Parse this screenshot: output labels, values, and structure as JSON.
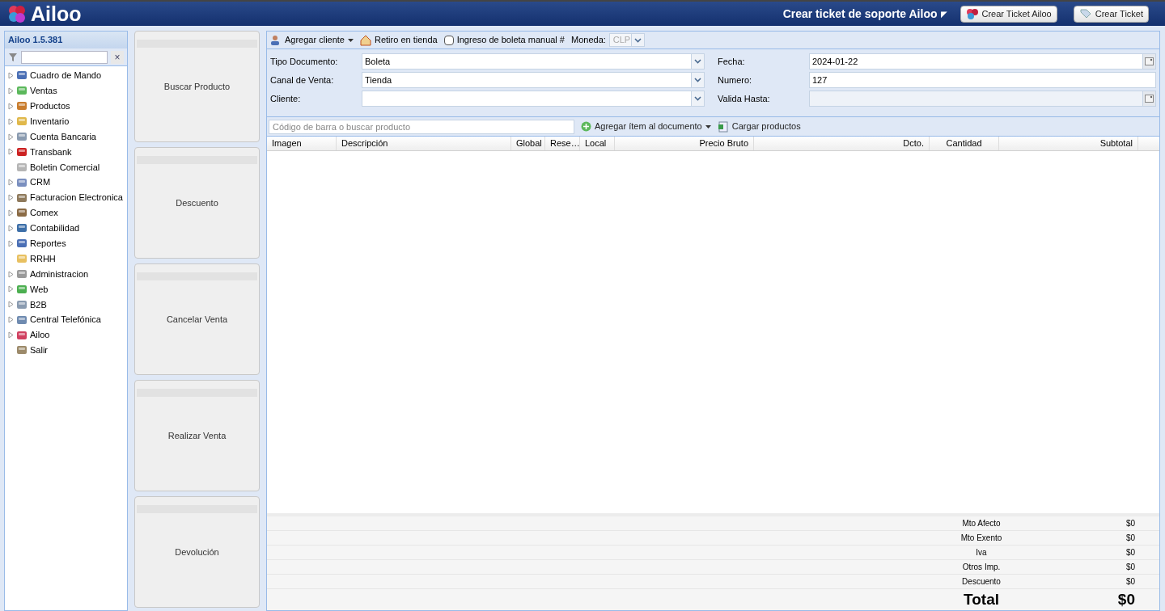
{
  "header": {
    "logo": "Ailoo",
    "support_title": "Crear ticket de soporte Ailoo",
    "support_caret": "◤",
    "buttons": [
      "Crear Ticket Ailoo",
      "Crear Ticket"
    ]
  },
  "sidebar": {
    "title": "Ailoo 1.5.381",
    "filter_clear": "×",
    "items": [
      {
        "label": "Cuadro de Mando",
        "expandable": true
      },
      {
        "label": "Ventas",
        "expandable": true
      },
      {
        "label": "Productos",
        "expandable": true
      },
      {
        "label": "Inventario",
        "expandable": true
      },
      {
        "label": "Cuenta Bancaria",
        "expandable": true
      },
      {
        "label": "Transbank",
        "expandable": true
      },
      {
        "label": "Boletin Comercial",
        "expandable": false
      },
      {
        "label": "CRM",
        "expandable": true
      },
      {
        "label": "Facturacion Electronica",
        "expandable": true
      },
      {
        "label": "Comex",
        "expandable": true
      },
      {
        "label": "Contabilidad",
        "expandable": true
      },
      {
        "label": "Reportes",
        "expandable": true
      },
      {
        "label": "RRHH",
        "expandable": false
      },
      {
        "label": "Administracion",
        "expandable": true
      },
      {
        "label": "Web",
        "expandable": true
      },
      {
        "label": "B2B",
        "expandable": true
      },
      {
        "label": "Central Telefónica",
        "expandable": true
      },
      {
        "label": "Ailoo",
        "expandable": true
      },
      {
        "label": "Salir",
        "expandable": false
      }
    ]
  },
  "actions": [
    "Buscar Producto",
    "Descuento",
    "Cancelar Venta",
    "Realizar Venta",
    "Devolución"
  ],
  "toolbar": {
    "add_client": "Agregar cliente",
    "pickup": "Retiro en tienda",
    "manual_receipt": {
      "label": "Ingreso de boleta manual #",
      "checked": false
    },
    "currency_label": "Moneda:",
    "currency": "CLP"
  },
  "form": {
    "left": [
      {
        "label": "Tipo Documento:",
        "value": "Boleta"
      },
      {
        "label": "Canal de Venta:",
        "value": "Tienda"
      },
      {
        "label": "Cliente:"
      }
    ],
    "right": [
      {
        "label": "Fecha:",
        "value": "2024-01-22",
        "kind": "date",
        "disabled": false
      },
      {
        "label": "Numero:",
        "value": "127",
        "kind": "text",
        "disabled": false
      },
      {
        "label": "Valida Hasta:",
        "kind": "date",
        "disabled": true
      }
    ]
  },
  "item_bar": {
    "placeholder": "Código de barra o buscar producto",
    "add_item": "Agregar ítem al documento",
    "load": "Cargar productos"
  },
  "table": {
    "columns": [
      "Imagen",
      "Descripción",
      "Global",
      "Rese…",
      "Local",
      "Precio Bruto",
      "Dcto.",
      "Cantidad",
      "Subtotal"
    ]
  },
  "totals": [
    {
      "label": "Mto Afecto",
      "value": "$0"
    },
    {
      "label": "Mto Exento",
      "value": "$0"
    },
    {
      "label": "Iva",
      "value": "$0"
    },
    {
      "label": "Otros Imp.",
      "value": "$0"
    },
    {
      "label": "Descuento",
      "value": "$0"
    }
  ],
  "total": {
    "label": "Total",
    "value": "$0"
  }
}
